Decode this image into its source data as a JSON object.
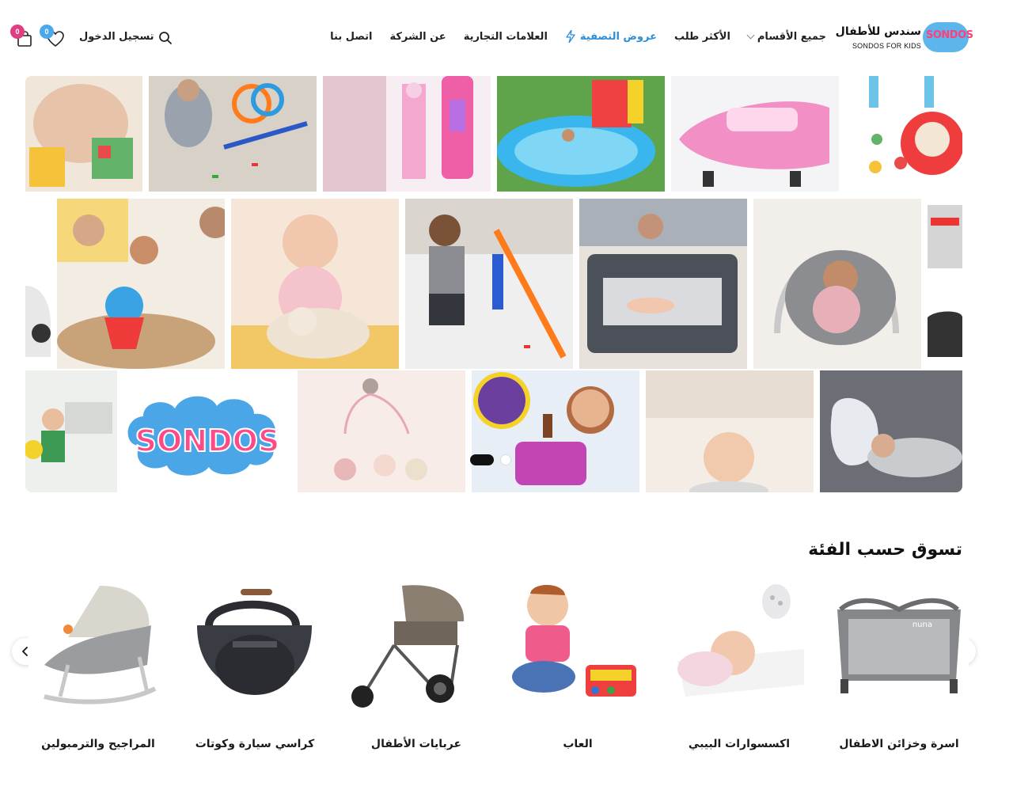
{
  "brand": {
    "logo_mark": "SONDOS",
    "name_ar": "سندس للأطفال",
    "name_en": "SONDOS FOR KIDS",
    "accent_color": "#2c8ed6",
    "pink_color": "#e23d83"
  },
  "nav": {
    "items": [
      {
        "label": "جميع الأقسام",
        "has_dropdown": true
      },
      {
        "label": "الأكثر طلب"
      },
      {
        "label": "عروض التصفية",
        "highlight": true,
        "icon": "bolt-icon"
      },
      {
        "label": "العلامات التجارية"
      },
      {
        "label": "عن الشركة"
      },
      {
        "label": "اتصل بنا"
      }
    ]
  },
  "header_actions": {
    "login_label": "تسجيل الدخول",
    "wishlist_count": "0",
    "cart_count": "0"
  },
  "hero": {
    "logo_text": "SONDOS",
    "slides": 2,
    "active_slide": 2,
    "tiles": [
      {
        "name": "baby-with-blocks",
        "color": "#e9d2c0"
      },
      {
        "name": "boy-racetrack",
        "color": "#cfc8be"
      },
      {
        "name": "barbie-dolls",
        "color": "#f2c9e0"
      },
      {
        "name": "inflatable-pool",
        "color": "#58c4ee"
      },
      {
        "name": "barbie-jet",
        "color": "#f0a9cf"
      },
      {
        "name": "baby-activity-table",
        "color": "#e8eef2"
      },
      {
        "name": "kids-playing-game",
        "color": "#d9c4a6"
      },
      {
        "name": "baby-teddy",
        "color": "#f6d9cf"
      },
      {
        "name": "boy-hot-wheels",
        "color": "#d8d4cf"
      },
      {
        "name": "mother-crib",
        "color": "#4f535a"
      },
      {
        "name": "baby-bouncer",
        "color": "#d9d4cc"
      },
      {
        "name": "puzzle-box",
        "color": "#c9c9c9"
      },
      {
        "name": "toddler-walker",
        "color": "#e7e9e6"
      },
      {
        "name": "sondos-logo-tile",
        "color": "#ffffff"
      },
      {
        "name": "crib-mobile",
        "color": "#f5e6e1"
      },
      {
        "name": "girl-play-doh",
        "color": "#dfe6ef"
      },
      {
        "name": "smiling-baby",
        "color": "#efe4d8"
      },
      {
        "name": "pregnancy-pillow",
        "color": "#6f737a"
      }
    ]
  },
  "categories": {
    "title": "تسوق حسب الفئة",
    "items": [
      {
        "label": "اسرة وخزائن الاطفال",
        "icon": "playard-image"
      },
      {
        "label": "اكسسوارات البيبي",
        "icon": "baby-pillow-image"
      },
      {
        "label": "العاب",
        "icon": "toddler-toy-image"
      },
      {
        "label": "عربايات الأطفال",
        "icon": "stroller-image"
      },
      {
        "label": "كراسي سيارة وكوتات",
        "icon": "car-seat-image"
      },
      {
        "label": "المراجيح والترمبولين",
        "icon": "baby-rocker-image"
      }
    ]
  }
}
